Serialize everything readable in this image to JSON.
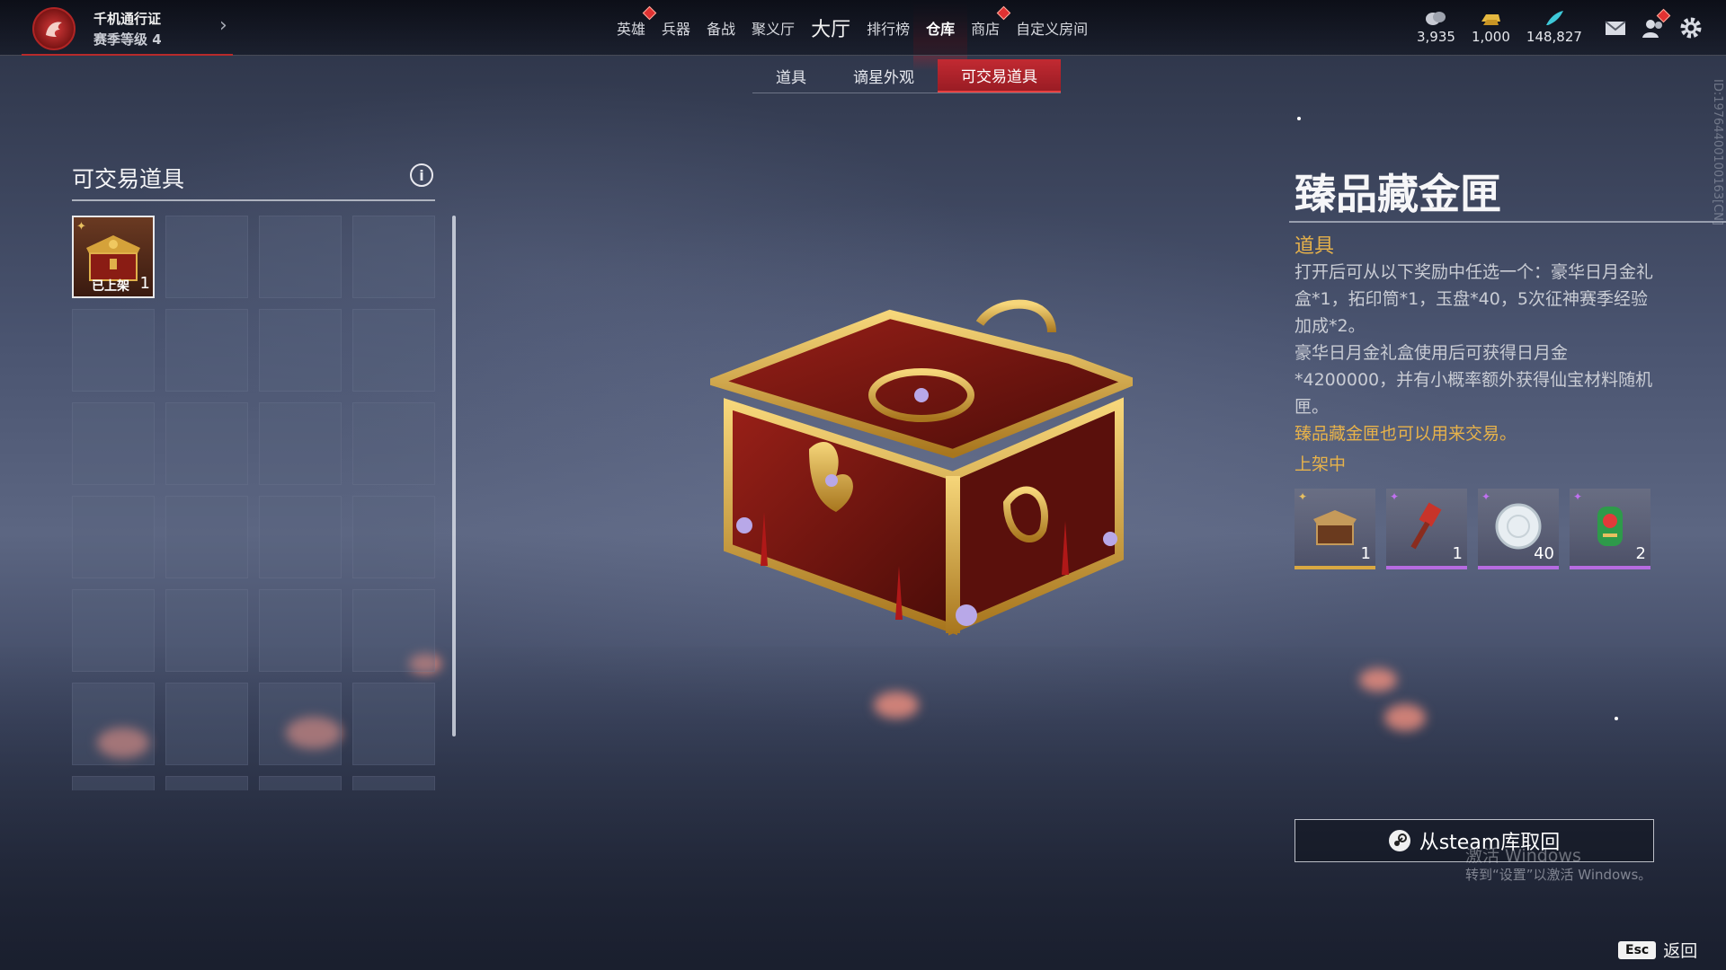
{
  "battle_pass": {
    "title": "千机通行证",
    "level": "赛季等级 4"
  },
  "nav": [
    {
      "label": "英雄",
      "badge": true
    },
    {
      "label": "兵器",
      "badge": false
    },
    {
      "label": "备战",
      "badge": false
    },
    {
      "label": "聚义厅",
      "badge": false
    },
    {
      "label": "大厅",
      "badge": false
    },
    {
      "label": "排行榜",
      "badge": false
    },
    {
      "label": "仓库",
      "badge": false,
      "active": true
    },
    {
      "label": "商店",
      "badge": true
    },
    {
      "label": "自定义房间",
      "badge": false
    }
  ],
  "currencies": [
    {
      "icon": "coin-icon",
      "value": "3,935"
    },
    {
      "icon": "gold-bar-icon",
      "value": "1,000"
    },
    {
      "icon": "feather-icon",
      "value": "148,827"
    }
  ],
  "top_icons": [
    "mail-icon",
    "friends-icon",
    "settings-icon"
  ],
  "subtabs": [
    "道具",
    "谪星外观",
    "可交易道具"
  ],
  "left_panel": {
    "title": "可交易道具",
    "first_item": {
      "tag": "已上架",
      "count": "1",
      "quality": "gold"
    }
  },
  "item": {
    "name": "臻品藏金匣",
    "type": "道具",
    "description": [
      "打开后可从以下奖励中任选一个：豪华日月金礼盒*1，拓印筒*1，玉盘*40，5次征神赛季经验加成*2。",
      "豪华日月金礼盒使用后可获得日月金*4200000，并有小概率额外获得仙宝材料随机匣。"
    ],
    "tradeable_note": "臻品藏金匣也可以用来交易。",
    "status": "上架中",
    "rewards": [
      {
        "icon": "chest-icon",
        "count": "1",
        "quality": "gold"
      },
      {
        "icon": "hammer-icon",
        "count": "1",
        "quality": "purple"
      },
      {
        "icon": "jade-plate-icon",
        "count": "40",
        "quality": "purple"
      },
      {
        "icon": "exp-boost-icon",
        "count": "2",
        "quality": "purple"
      }
    ]
  },
  "steam_button": "从steam库取回",
  "windows_watermark": {
    "line1": "激活 Windows",
    "line2": "转到“设置”以激活 Windows。"
  },
  "uid": "ID:19764400100163[CN]",
  "esc": {
    "key": "Esc",
    "label": "返回"
  },
  "colors": {
    "accent_red": "#c22a32",
    "gold": "#e7b24a",
    "purple": "#b66be0"
  }
}
